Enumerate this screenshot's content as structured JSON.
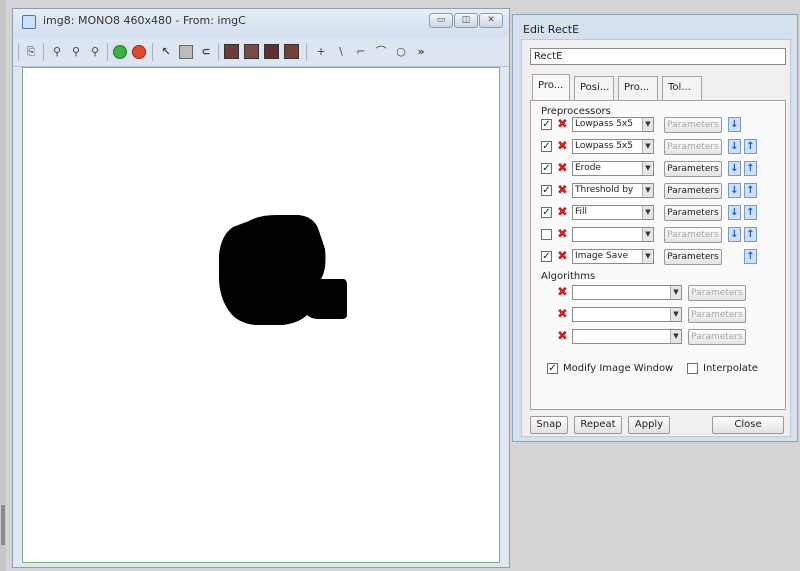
{
  "image_window": {
    "title": "img8: MONO8 460x480 - From: imgC",
    "buttons": {
      "minimize": "▭",
      "maximize": "◫",
      "close": "✕"
    },
    "toolbar_icons": [
      "save-icon",
      "zoom-fit-icon",
      "zoom-in-icon",
      "zoom-out-icon",
      "play-green-icon",
      "stop-red-icon",
      "pointer-icon",
      "display-icon",
      "link-icon",
      "image1-icon",
      "image2-icon",
      "image3-icon",
      "image4-icon",
      "crosshair-icon",
      "line-icon",
      "polyline-icon",
      "arc-icon",
      "polygon-icon",
      "more-icon"
    ],
    "toolbar_glyphs": {
      "save": "⎘",
      "zoom_fit": "⚲",
      "zoom_in": "⚲",
      "zoom_out": "⚲",
      "pointer": "↖",
      "link": "⊂",
      "crosshair": "+",
      "line": "\\",
      "polyline": "⌐",
      "arc": "⌒",
      "polygon": "○",
      "more": "»"
    },
    "colors": {
      "canvas_border": "#7ab07a",
      "blob": "#000000"
    }
  },
  "edit_panel": {
    "title": "Edit RectE",
    "name_value": "RectE",
    "tabs": [
      "Pro...",
      "Posi...",
      "Pro...",
      "Tol..."
    ],
    "preprocessors_label": "Preprocessors",
    "preprocessors": [
      {
        "checked": "✓",
        "name": "Lowpass 5x5",
        "param": "Parameters",
        "param_enabled": false,
        "down": "↓",
        "up": ""
      },
      {
        "checked": "✓",
        "name": "Lowpass 5x5",
        "param": "Parameters",
        "param_enabled": false,
        "down": "↓",
        "up": "↑"
      },
      {
        "checked": "✓",
        "name": "Erode",
        "param": "Parameters",
        "param_enabled": true,
        "down": "↓",
        "up": "↑"
      },
      {
        "checked": "✓",
        "name": "Threshold by",
        "param": "Parameters",
        "param_enabled": true,
        "down": "↓",
        "up": "↑"
      },
      {
        "checked": "✓",
        "name": "Fill",
        "param": "Parameters",
        "param_enabled": true,
        "down": "↓",
        "up": "↑"
      },
      {
        "checked": "",
        "name": "",
        "param": "Parameters",
        "param_enabled": false,
        "down": "↓",
        "up": "↑"
      },
      {
        "checked": "✓",
        "name": "Image Save",
        "param": "Parameters",
        "param_enabled": true,
        "down": "",
        "up": "↑"
      }
    ],
    "algorithms_label": "Algorithms",
    "algorithms": [
      {
        "name": "",
        "param": "Parameters"
      },
      {
        "name": "",
        "param": "Parameters"
      },
      {
        "name": "",
        "param": "Parameters"
      }
    ],
    "modify_image_window": {
      "checked": "✓",
      "label": "Modify Image Window"
    },
    "interpolate": {
      "checked": "",
      "label": "Interpolate"
    },
    "buttons": {
      "snap": "Snap",
      "repeat": "Repeat",
      "apply": "Apply",
      "close": "Close"
    },
    "glyphs": {
      "remove": "✖",
      "dropdown": "▼"
    }
  }
}
